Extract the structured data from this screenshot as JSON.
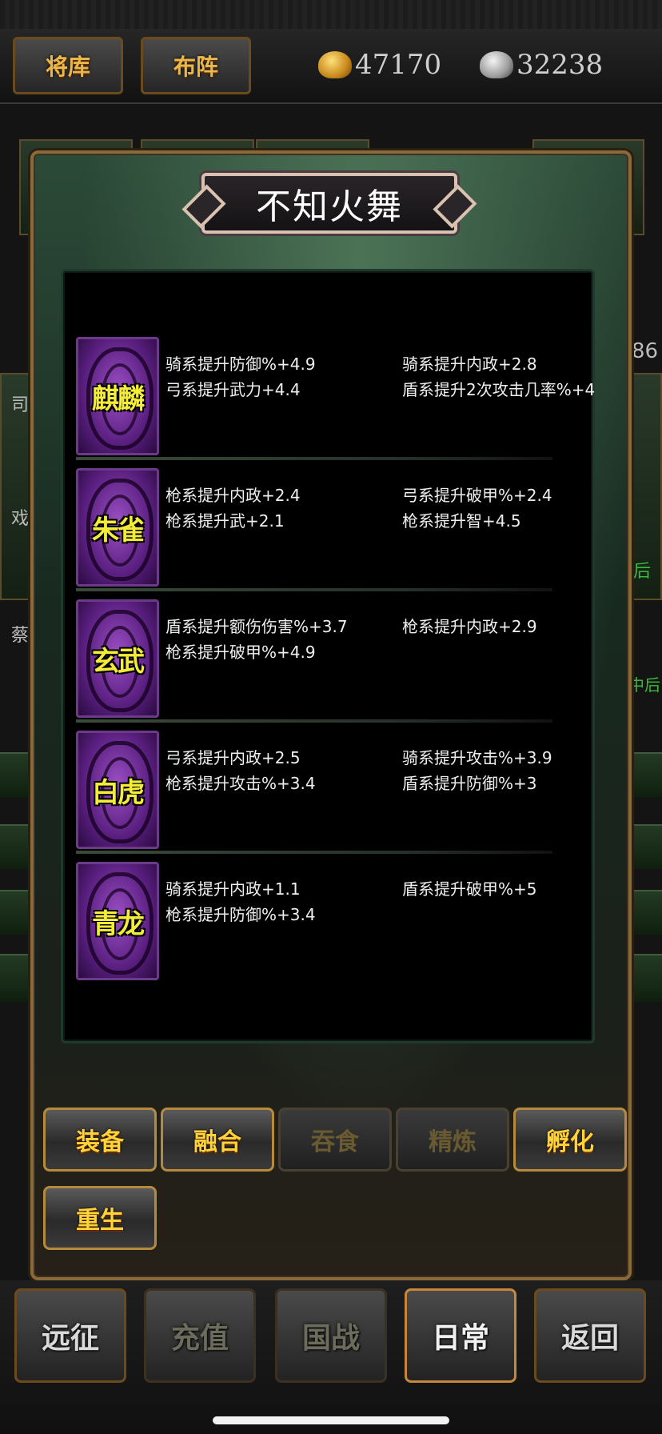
{
  "top_bar": {
    "btn_generals": "将库",
    "btn_formation": "布阵",
    "gold_amount": "47170",
    "silver_amount": "32238"
  },
  "background": {
    "side_text_1": "司",
    "side_text_2": "戏",
    "side_text_3": "蔡",
    "side_text_86": "86",
    "side_text_hou": "后",
    "side_text_zhonghou": "中后"
  },
  "dialog": {
    "title": "不知火舞",
    "items": [
      {
        "emblem": "麒麟",
        "attrs": [
          "骑系提升防御%+4.9",
          "骑系提升内政+2.8",
          "弓系提升武力+4.4",
          "盾系提升2次攻击几率%+4"
        ]
      },
      {
        "emblem": "朱雀",
        "attrs": [
          "枪系提升内政+2.4",
          "弓系提升破甲%+2.4",
          "枪系提升武+2.1",
          "枪系提升智+4.5"
        ]
      },
      {
        "emblem": "玄武",
        "attrs": [
          "盾系提升额伤伤害%+3.7",
          "枪系提升内政+2.9",
          "枪系提升破甲%+4.9",
          ""
        ]
      },
      {
        "emblem": "白虎",
        "attrs": [
          "弓系提升内政+2.5",
          "骑系提升攻击%+3.9",
          "枪系提升攻击%+3.4",
          "盾系提升防御%+3"
        ]
      },
      {
        "emblem": "青龙",
        "attrs": [
          "骑系提升内政+1.1",
          "盾系提升破甲%+5",
          "枪系提升防御%+3.4",
          ""
        ]
      }
    ],
    "actions": {
      "equip": "装备",
      "fuse": "融合",
      "devour": "吞食",
      "refine": "精炼",
      "hatch": "孵化",
      "rebirth": "重生"
    }
  },
  "bottom_nav": {
    "expedition": "远征",
    "recharge": "充值",
    "nation_war": "国战",
    "daily": "日常",
    "back": "返回"
  }
}
